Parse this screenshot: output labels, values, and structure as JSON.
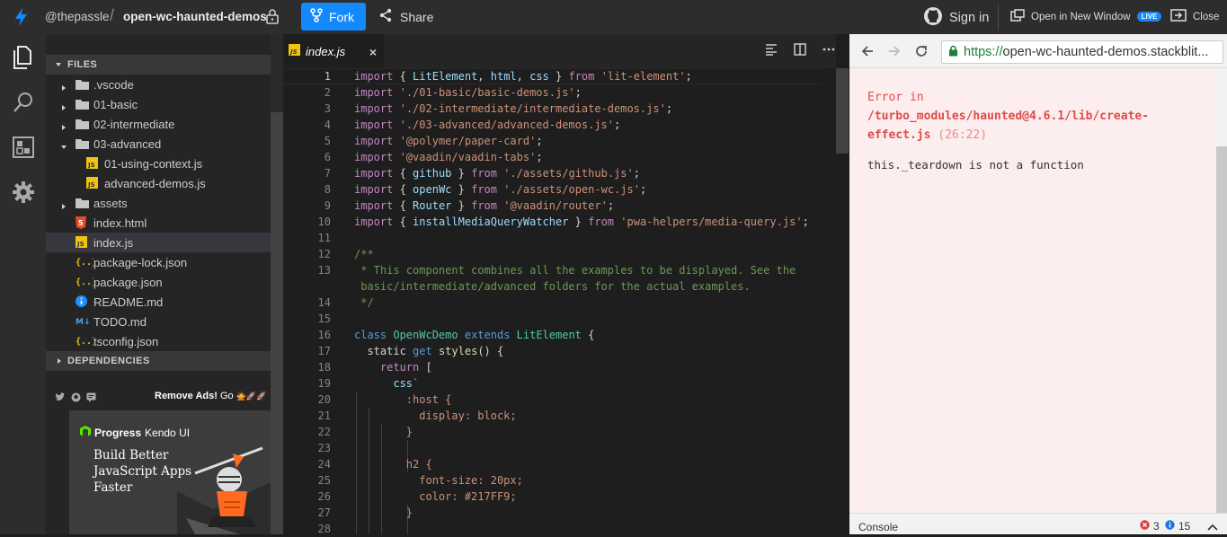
{
  "header": {
    "user": "@thepassle",
    "separator": "/",
    "project": "open-wc-haunted-demos",
    "fork_label": "Fork",
    "share_label": "Share",
    "signin_label": "Sign in",
    "open_window_label": "Open in New Window",
    "live_badge": "LIVE",
    "close_label": "Close",
    "accent_color": "#1389fd"
  },
  "sidebar": {
    "files_header": "FILES",
    "tree": [
      {
        "name": ".vscode",
        "type": "folder",
        "depth": 0,
        "expanded": false
      },
      {
        "name": "01-basic",
        "type": "folder",
        "depth": 0,
        "expanded": false
      },
      {
        "name": "02-intermediate",
        "type": "folder",
        "depth": 0,
        "expanded": false
      },
      {
        "name": "03-advanced",
        "type": "folder",
        "depth": 0,
        "expanded": true
      },
      {
        "name": "01-using-context.js",
        "type": "js",
        "depth": 1
      },
      {
        "name": "advanced-demos.js",
        "type": "js",
        "depth": 1
      },
      {
        "name": "assets",
        "type": "folder",
        "depth": 0,
        "expanded": false
      },
      {
        "name": "index.html",
        "type": "html",
        "depth": 0
      },
      {
        "name": "index.js",
        "type": "js",
        "depth": 0,
        "selected": true
      },
      {
        "name": "package-lock.json",
        "type": "json",
        "depth": 0
      },
      {
        "name": "package.json",
        "type": "json",
        "depth": 0
      },
      {
        "name": "README.md",
        "type": "info",
        "depth": 0
      },
      {
        "name": "TODO.md",
        "type": "md",
        "depth": 0
      },
      {
        "name": "tsconfig.json",
        "type": "json",
        "depth": 0
      }
    ],
    "dependencies_header": "DEPENDENCIES",
    "ad": {
      "remove_ads": "Remove Ads!",
      "go": "Go",
      "brand_bold": "Progress",
      "brand_rest": "Kendo UI",
      "tagline": "Build Better JavaScript Apps Faster"
    }
  },
  "editor": {
    "tab_label": "index.js",
    "tab_close": "×",
    "lines": [
      {
        "n": "1",
        "html": "<span class='p'>import</span> { <span class='v'>LitElement</span>, <span class='v'>html</span>, <span class='v'>css</span> } <span class='p'>from</span> <span class='s'>'lit-element'</span>;"
      },
      {
        "n": "2",
        "html": "<span class='p'>import</span> <span class='s'>'./01-basic/basic-demos.js'</span>;"
      },
      {
        "n": "3",
        "html": "<span class='p'>import</span> <span class='s'>'./02-intermediate/intermediate-demos.js'</span>;"
      },
      {
        "n": "4",
        "html": "<span class='p'>import</span> <span class='s'>'./03-advanced/advanced-demos.js'</span>;"
      },
      {
        "n": "5",
        "html": "<span class='p'>import</span> <span class='s'>'@polymer/paper-card'</span>;"
      },
      {
        "n": "6",
        "html": "<span class='p'>import</span> <span class='s'>'@vaadin/vaadin-tabs'</span>;"
      },
      {
        "n": "7",
        "html": "<span class='p'>import</span> { <span class='v'>github</span> } <span class='p'>from</span> <span class='s'>'./assets/github.js'</span>;"
      },
      {
        "n": "8",
        "html": "<span class='p'>import</span> { <span class='v'>openWc</span> } <span class='p'>from</span> <span class='s'>'./assets/open-wc.js'</span>;"
      },
      {
        "n": "9",
        "html": "<span class='p'>import</span> { <span class='v'>Router</span> } <span class='p'>from</span> <span class='s'>'@vaadin/router'</span>;"
      },
      {
        "n": "10",
        "html": "<span class='p'>import</span> { <span class='v'>installMediaQueryWatcher</span> } <span class='p'>from</span> <span class='s'>'pwa-helpers/media-query.js'</span>;"
      },
      {
        "n": "11",
        "html": ""
      },
      {
        "n": "12",
        "html": "<span class='c'>/**</span>"
      },
      {
        "n": "13",
        "html": "<span class='c'> * This component combines all the examples to be displayed. See the</span>"
      },
      {
        "n": "",
        "html": "<span class='c'> basic/intermediate/advanced folders for the actual examples.</span>"
      },
      {
        "n": "14",
        "html": "<span class='c'> */</span>"
      },
      {
        "n": "15",
        "html": ""
      },
      {
        "n": "16",
        "html": "<span class='k'>class</span> <span class='t'>OpenWcDemo</span> <span class='k'>extends</span> <span class='t'>LitElement</span> {"
      },
      {
        "n": "17",
        "html": "  static <span class='k'>get</span> <span class='f'>styles</span>() {"
      },
      {
        "n": "18",
        "html": "    <span class='p'>return</span> ["
      },
      {
        "n": "19",
        "html": "      <span class='v'>css</span><span class='s'>`</span>"
      },
      {
        "n": "20",
        "html": "<span class='s'>        :host {</span>"
      },
      {
        "n": "21",
        "html": "<span class='s'>          display: block;</span>"
      },
      {
        "n": "22",
        "html": "<span class='s'>        }</span>"
      },
      {
        "n": "23",
        "html": ""
      },
      {
        "n": "24",
        "html": "<span class='s'>        h2 {</span>"
      },
      {
        "n": "25",
        "html": "<span class='s'>          font-size: 20px;</span>"
      },
      {
        "n": "26",
        "html": "<span class='s'>          color: #217FF9;</span>"
      },
      {
        "n": "27",
        "html": "<span class='s'>        }</span>"
      },
      {
        "n": "28",
        "html": ""
      }
    ]
  },
  "preview": {
    "url_scheme": "https://",
    "url_host": "open-wc-haunted-demos.stackblit...",
    "error_prefix": "Error in",
    "error_path": "/turbo_modules/haunted@4.6.1/lib/create-effect.js",
    "error_location": "(26:22)",
    "error_message": "this._teardown is not a function",
    "console_label": "Console",
    "error_count": "3",
    "info_count": "15"
  }
}
